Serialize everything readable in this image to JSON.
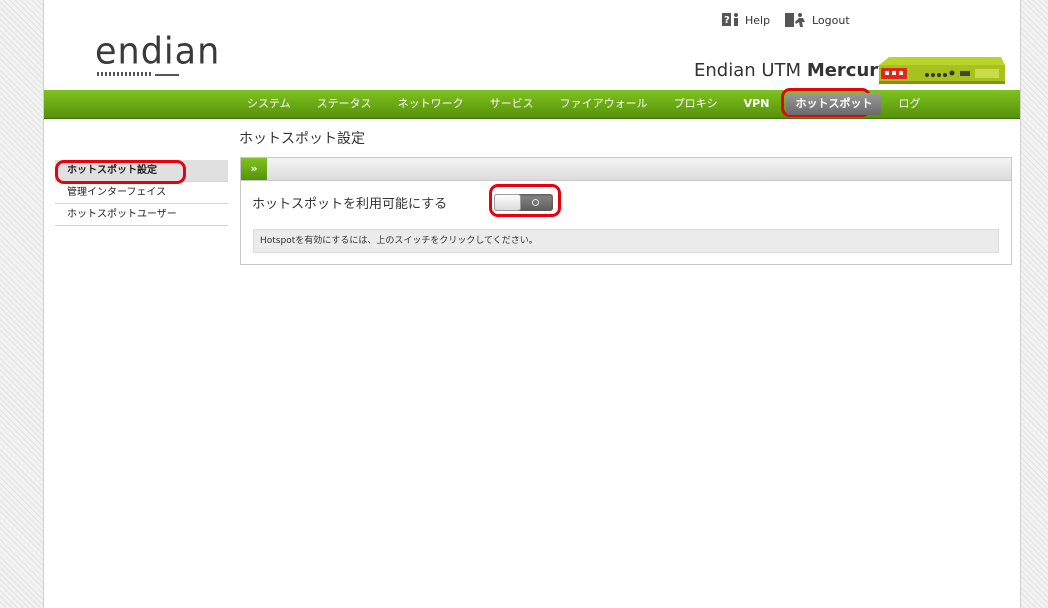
{
  "header": {
    "logo_text": "endian",
    "help_label": "Help",
    "logout_label": "Logout",
    "product_name_regular": "Endian UTM",
    "product_name_bold": "Mercury",
    "device_label": "Endian device image"
  },
  "nav": {
    "items": [
      {
        "label": "システム"
      },
      {
        "label": "ステータス"
      },
      {
        "label": "ネットワーク"
      },
      {
        "label": "サービス"
      },
      {
        "label": "ファイアウォール"
      },
      {
        "label": "プロキシ"
      },
      {
        "label": "VPN"
      },
      {
        "label": "ホットスポット"
      },
      {
        "label": "ログ"
      }
    ],
    "active": "ホットスポット"
  },
  "sidebar": {
    "items": [
      {
        "label": "ホットスポット設定"
      },
      {
        "label": "管理インターフェイス"
      },
      {
        "label": "ホットスポットユーザー"
      }
    ],
    "active": "ホットスポット設定"
  },
  "main": {
    "page_title": "ホットスポット設定",
    "collapse_glyph": "»",
    "enable_label": "ホットスポットを利用可能にする",
    "toggle_state": "off",
    "hint_text": "Hotspotを有効にするには、上のスイッチをクリックしてください。"
  },
  "colors": {
    "nav_green": "#6aab14",
    "highlight_red": "#e8000e",
    "active_tab": "#7a7a7a"
  }
}
